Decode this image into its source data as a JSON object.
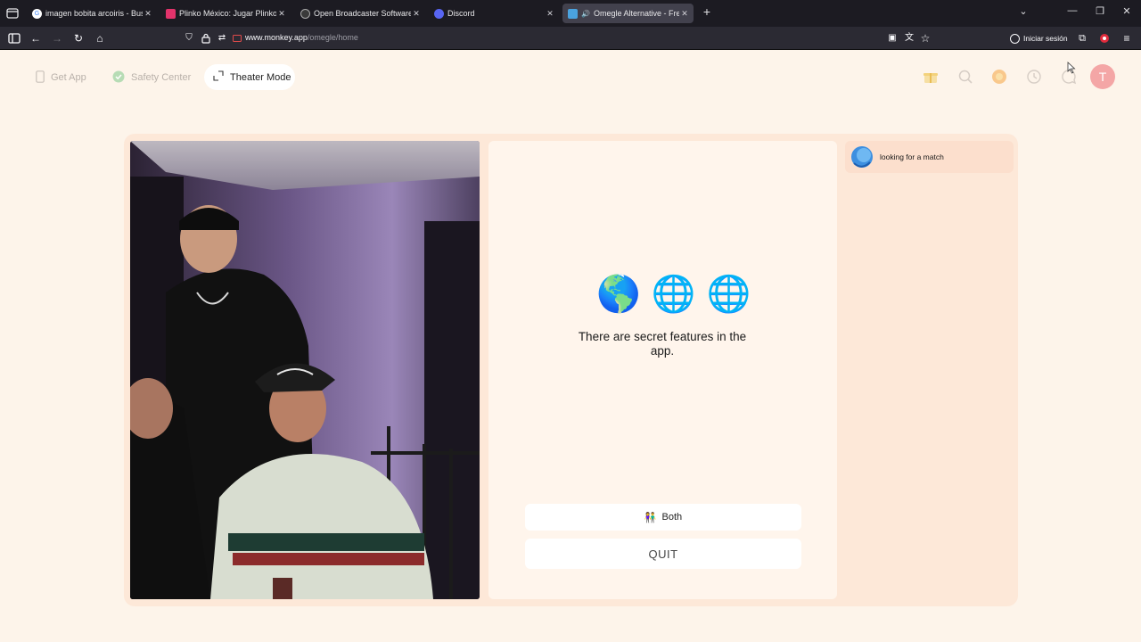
{
  "browser": {
    "tabs": [
      {
        "title": "imagen bobita arcoiris - Buscar",
        "favicon": "google-icon",
        "active": false
      },
      {
        "title": "Plinko México: Jugar Plinko Casino",
        "favicon": "plinko-icon",
        "active": false
      },
      {
        "title": "Open Broadcaster Software | OBS",
        "favicon": "obs-icon",
        "active": false
      },
      {
        "title": "Discord",
        "favicon": "discord-icon",
        "active": false
      },
      {
        "title": "Omegle Alternative - Free Video Chat",
        "favicon": "monkey-icon",
        "active": true
      }
    ],
    "url_host": "www.monkey.app",
    "url_path": "/omegle/home",
    "sign_in_label": "Iniciar sesión"
  },
  "header": {
    "get_app_label": "Get App",
    "safety_center_label": "Safety Center",
    "theater_mode_label": "Theater Mode",
    "user_initial": "T"
  },
  "panel": {
    "globes": [
      "🌎",
      "🌐",
      "🌐"
    ],
    "tip": "There are secret features in the app.",
    "both_icon": "👫",
    "both_label": "Both",
    "quit_label": "QUIT"
  },
  "chat": {
    "status_message": "looking for a match"
  },
  "colors": {
    "page_bg": "#fdf4ea",
    "card_bg": "#fde8d8",
    "panel_bg": "#fff5ec",
    "chat_bubble": "#fcdfcd",
    "accent_pink": "#f4a6a6"
  }
}
